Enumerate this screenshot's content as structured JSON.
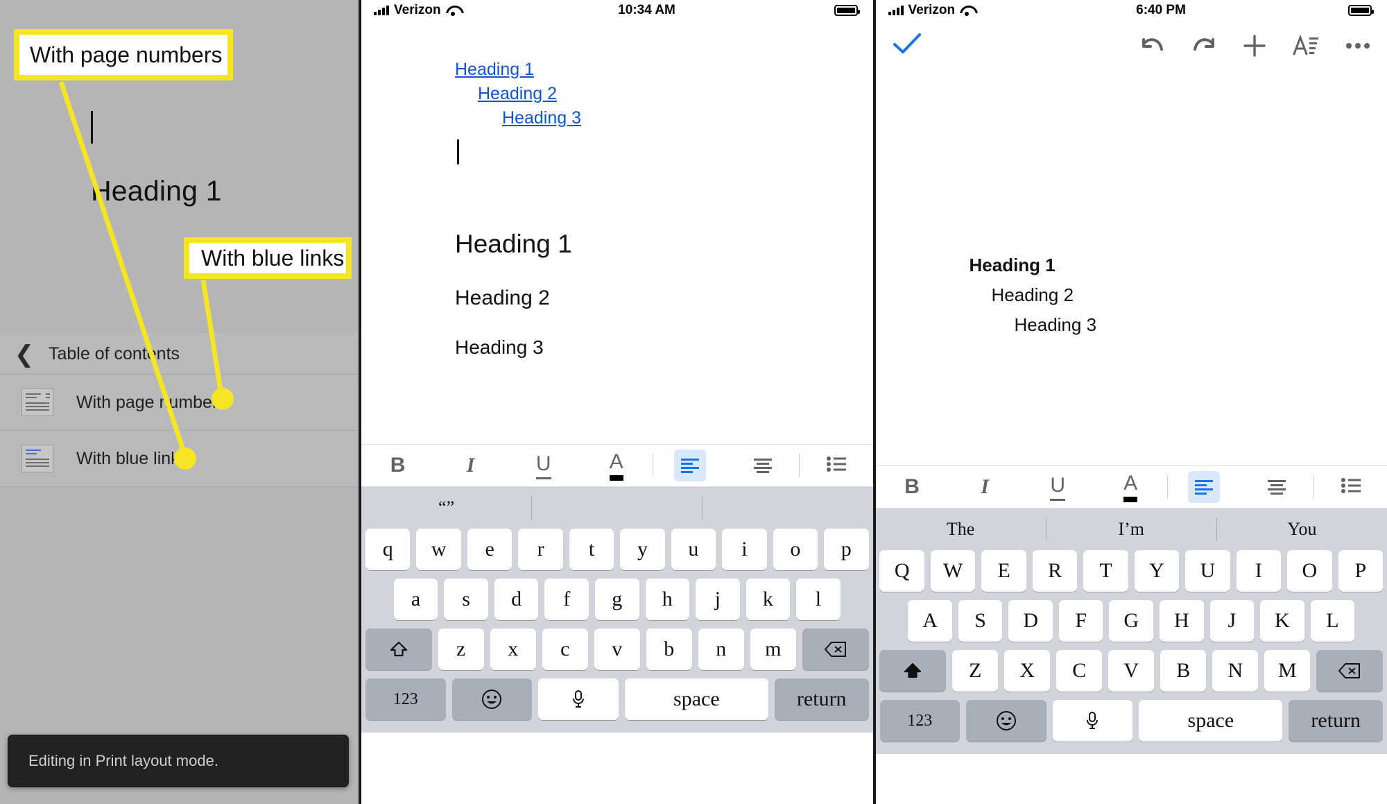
{
  "left_panel": {
    "background_color": "#b5b5b5",
    "document": {
      "caret": "|",
      "heading_1": "Heading 1"
    },
    "toc_menu": {
      "back_icon": "back-chevron-icon",
      "title": "Table of contents",
      "items": [
        {
          "label": "With page numbers",
          "icon": "toc-page-numbers-icon"
        },
        {
          "label": "With blue links",
          "icon": "toc-blue-links-icon"
        }
      ]
    },
    "toast": {
      "message": "Editing in Print layout mode."
    },
    "annotations": {
      "highlight_color": "#f5e524",
      "callouts": [
        {
          "id": "callout-pagenumbers",
          "text": "With page numbers"
        },
        {
          "id": "callout-bluelinks",
          "text": "With blue links"
        }
      ]
    }
  },
  "middle_phone": {
    "statusbar": {
      "carrier": "Verizon",
      "time": "10:34 AM",
      "signal_icon": "cellular-bars-icon",
      "wifi_icon": "wifi-icon",
      "battery_icon": "battery-full-icon"
    },
    "document": {
      "toc_entries": [
        {
          "text": "Heading 1",
          "indent": 0
        },
        {
          "text": "Heading 2",
          "indent": 1
        },
        {
          "text": "Heading 3",
          "indent": 2
        }
      ],
      "caret": "|",
      "body_headings": [
        "Heading 1",
        "Heading 2",
        "Heading 3"
      ],
      "link_color": "#1155cc"
    },
    "format_toolbar": {
      "buttons": [
        {
          "name": "bold-button",
          "glyph": "B"
        },
        {
          "name": "italic-button",
          "glyph": "I"
        },
        {
          "name": "underline-button",
          "glyph": "U"
        },
        {
          "name": "text-color-button",
          "glyph": "A"
        },
        {
          "name": "align-left-button",
          "glyph": "align-left-icon",
          "active": true
        },
        {
          "name": "align-center-button",
          "glyph": "align-center-icon",
          "active": false
        },
        {
          "name": "bullet-list-button",
          "glyph": "bullet-list-icon",
          "active": false
        }
      ],
      "active_color": "#d9e7fd"
    },
    "keyboard": {
      "predictions": [
        "“”",
        "",
        ""
      ],
      "row1": [
        "q",
        "w",
        "e",
        "r",
        "t",
        "y",
        "u",
        "i",
        "o",
        "p"
      ],
      "row2": [
        "a",
        "s",
        "d",
        "f",
        "g",
        "h",
        "j",
        "k",
        "l"
      ],
      "row3": [
        "z",
        "x",
        "c",
        "v",
        "b",
        "n",
        "m"
      ],
      "shift_key": "shift-up-outline-icon",
      "backspace_key": "backspace-icon",
      "numbers_key": "123",
      "emoji_key": "emoji-icon",
      "mic_key": "microphone-icon",
      "space_key": "space",
      "return_key": "return"
    }
  },
  "right_phone": {
    "statusbar": {
      "carrier": "Verizon",
      "time": "6:40 PM",
      "signal_icon": "cellular-bars-icon",
      "wifi_icon": "wifi-icon",
      "battery_icon": "battery-full-icon"
    },
    "appbar": {
      "accept_icon": "checkmark-icon",
      "accept_color": "#1a73e8",
      "tools": [
        {
          "name": "undo-button",
          "icon": "undo-icon"
        },
        {
          "name": "redo-button",
          "icon": "redo-icon"
        },
        {
          "name": "insert-button",
          "icon": "plus-icon"
        },
        {
          "name": "format-button",
          "icon": "format-text-icon"
        },
        {
          "name": "more-options-button",
          "icon": "ellipsis-icon"
        }
      ]
    },
    "document": {
      "toc_entries": [
        {
          "text": "Heading 1",
          "indent": 0,
          "bold": true
        },
        {
          "text": "Heading 2",
          "indent": 1,
          "bold": false
        },
        {
          "text": "Heading 3",
          "indent": 2,
          "bold": false
        }
      ]
    },
    "format_toolbar": {
      "buttons": [
        {
          "name": "bold-button",
          "glyph": "B"
        },
        {
          "name": "italic-button",
          "glyph": "I"
        },
        {
          "name": "underline-button",
          "glyph": "U"
        },
        {
          "name": "text-color-button",
          "glyph": "A"
        },
        {
          "name": "align-left-button",
          "glyph": "align-left-icon",
          "active": true
        },
        {
          "name": "align-center-button",
          "glyph": "align-center-icon",
          "active": false
        },
        {
          "name": "bullet-list-button",
          "glyph": "bullet-list-icon",
          "active": false
        }
      ]
    },
    "keyboard": {
      "predictions": [
        "The",
        "I’m",
        "You"
      ],
      "row1": [
        "Q",
        "W",
        "E",
        "R",
        "T",
        "Y",
        "U",
        "I",
        "O",
        "P"
      ],
      "row2": [
        "A",
        "S",
        "D",
        "F",
        "G",
        "H",
        "J",
        "K",
        "L"
      ],
      "row3": [
        "Z",
        "X",
        "C",
        "V",
        "B",
        "N",
        "M"
      ],
      "shift_key": "shift-up-filled-icon",
      "backspace_key": "backspace-icon",
      "numbers_key": "123",
      "emoji_key": "emoji-icon",
      "mic_key": "microphone-icon",
      "space_key": "space",
      "return_key": "return"
    }
  }
}
